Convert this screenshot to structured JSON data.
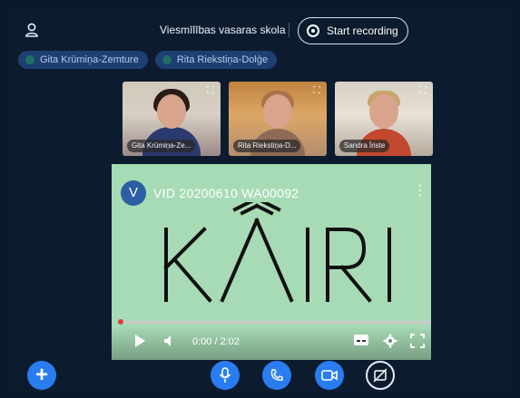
{
  "header": {
    "room_title": "Viesmīlības vasaras skola",
    "record_label": "Start recording"
  },
  "talkers": [
    {
      "name": "Gita Krūmiņa-Zemture"
    },
    {
      "name": "Rita Riekstiņa-Dolģe"
    }
  ],
  "webcams": [
    {
      "name": "Gita Krūmiņa-Ze..."
    },
    {
      "name": "Rita Riekstiņa-D..."
    },
    {
      "name": "Sandra Īriste"
    }
  ],
  "video": {
    "avatar_letter": "V",
    "title": "VID 20200610 WA00092",
    "logo_text": "KĀIRI",
    "time": "0:00 / 2:02",
    "progress": 0
  },
  "actions": {
    "icons": [
      "plus-icon",
      "microphone-icon",
      "phone-icon",
      "camera-icon",
      "screen-share-icon"
    ]
  }
}
